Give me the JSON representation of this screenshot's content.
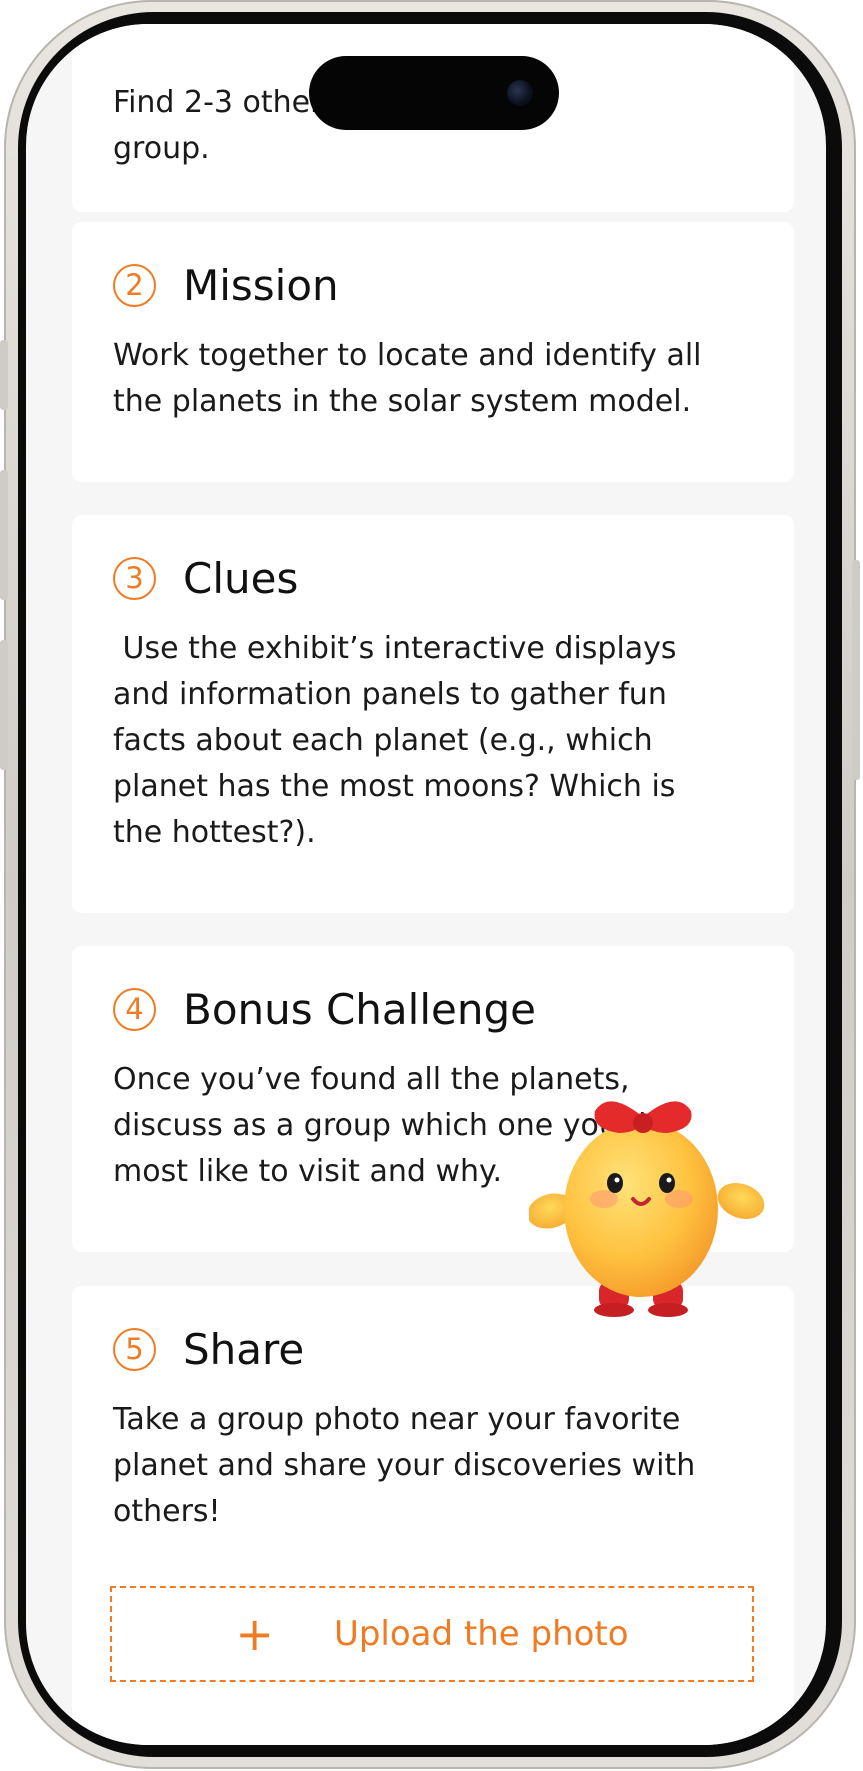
{
  "cards": [
    {
      "number": "",
      "title": "",
      "body": "Find 2-3 others to join in your\ngroup."
    },
    {
      "number": "2",
      "title": "Mission",
      "body": "Work together to locate and identify all\nthe planets in the solar system model."
    },
    {
      "number": "3",
      "title": "Clues",
      "body": " Use the exhibit’s interactive displays\nand information panels to gather fun\nfacts about each planet (e.g., which\nplanet has the most moons? Which is\nthe hottest?)."
    },
    {
      "number": "4",
      "title": "Bonus Challenge",
      "body": "Once you’ve found all the planets,\ndiscuss as a group which one you’d\nmost like to visit and why."
    },
    {
      "number": "5",
      "title": "Share",
      "body": "Take a group photo near your favorite\nplanet and share your discoveries with\nothers!"
    }
  ],
  "upload": {
    "icon": "plus-icon",
    "label": "Upload the photo"
  },
  "mascot": {
    "icon": "chick-mascot-icon"
  },
  "colors": {
    "accent": "#f07b22",
    "card": "#ffffff",
    "background": "#f6f6f6",
    "text": "#1a1a1a"
  }
}
